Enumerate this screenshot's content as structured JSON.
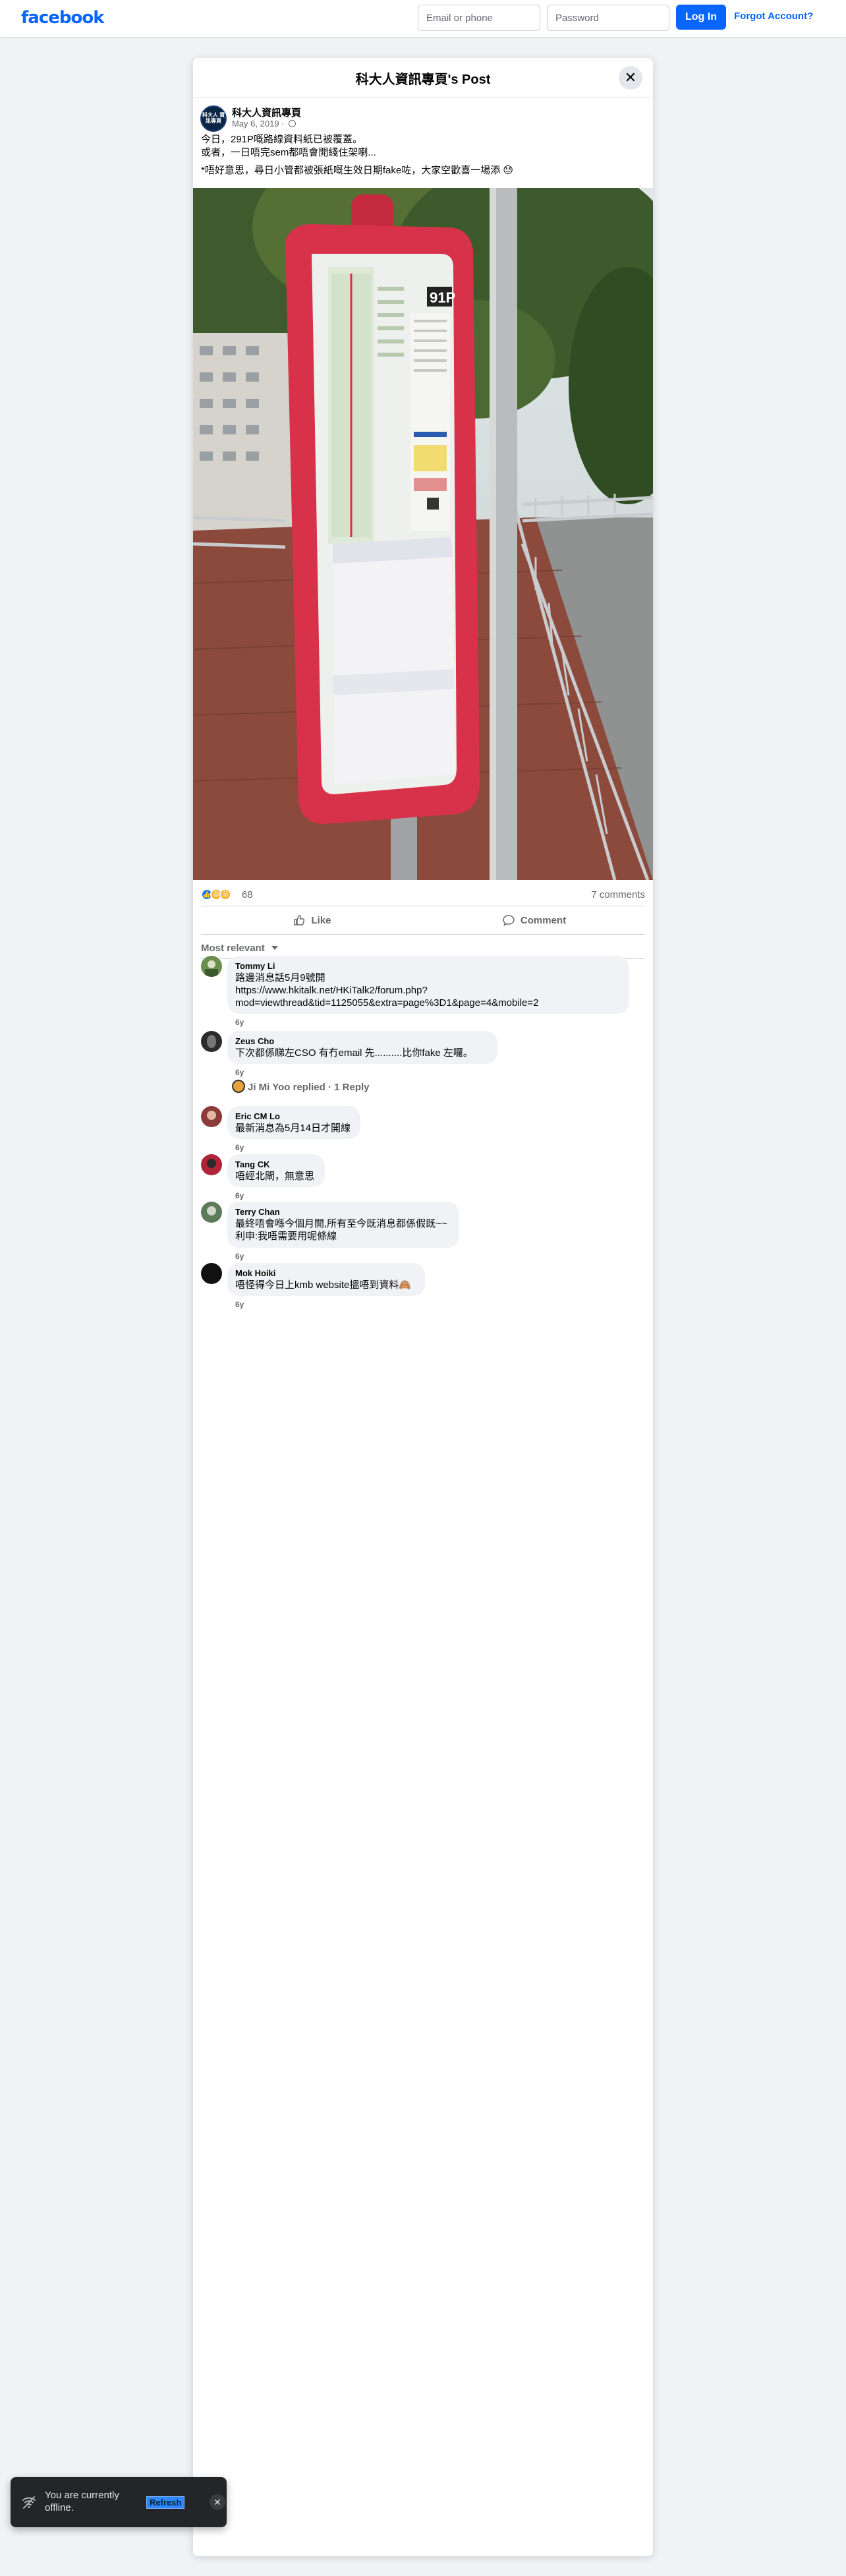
{
  "topbar": {
    "logo": "facebook",
    "email_placeholder": "Email or phone",
    "password_placeholder": "Password",
    "login_label": "Log In",
    "forgot_label": "Forgot Account?"
  },
  "modal": {
    "title": "科大人資訊專頁's Post",
    "close_symbol": "✕"
  },
  "post": {
    "page_name": "科大人資訊專頁",
    "avatar_text": "科大人 資訊專頁",
    "date": "May 6, 2019 · ",
    "text_lines": [
      "今日，291P嘅路線資料紙已被覆蓋。",
      "或者，一日唔完sem都唔會開綫住架喇...",
      "*唔好意思，尋日小管都被張紙嘅生效日期fake咗，大家空歡喜一場添 😓"
    ],
    "photo_alt": "bus stop pole 91P",
    "route_sign": "91P",
    "reactions_count": "68",
    "comments_count": "7 comments",
    "like_label": "Like",
    "comment_label": "Comment",
    "sort_label": "Most relevant"
  },
  "comments": [
    {
      "name": "Tommy Li",
      "lines": [
        "路邊消息話5月9號開",
        "https://www.hkitalk.net/HKiTalk2/forum.php?",
        "mod=viewthread&tid=1125055&extra=page%3D1&page=4&mobile=2"
      ],
      "age": "6y",
      "avatar_color": "#6a8f4e"
    },
    {
      "name": "Zeus Cho",
      "lines": [
        "下次都係睇左CSO 有冇email 先..........比你fake 左囉。"
      ],
      "age": "6y",
      "avatar_color": "#2b2b2b"
    },
    {
      "name": "Eric CM Lo",
      "lines": [
        "最新消息為5月14日才開線"
      ],
      "age": "6y",
      "avatar_color": "#8c3a3a"
    },
    {
      "name": "Tang CK",
      "lines": [
        "唔經北閘，無意思"
      ],
      "age": "6y",
      "avatar_color": "#b0243a"
    },
    {
      "name": "Terry Chan",
      "lines": [
        "最終唔會喺今個月開,所有至今既消息都係假既~~",
        "利申:我唔需要用呢條線"
      ],
      "age": "6y",
      "avatar_color": "#5d7a5a"
    },
    {
      "name": "Mok Hoiki",
      "lines": [
        "唔怪得今日上kmb website搵唔到資料🙈"
      ],
      "age": "6y",
      "avatar_color": "#111111"
    }
  ],
  "reply_summary": "Ji Mi Yoo replied · 1 Reply",
  "toast": {
    "text": "You are currently offline.",
    "refresh_label": "Refresh",
    "close_symbol": "✕"
  },
  "colors": {
    "brand": "#0866ff",
    "like_blue": "#1877f2",
    "haha_yellow": "#f7b125",
    "sign_red": "#d8324a"
  }
}
